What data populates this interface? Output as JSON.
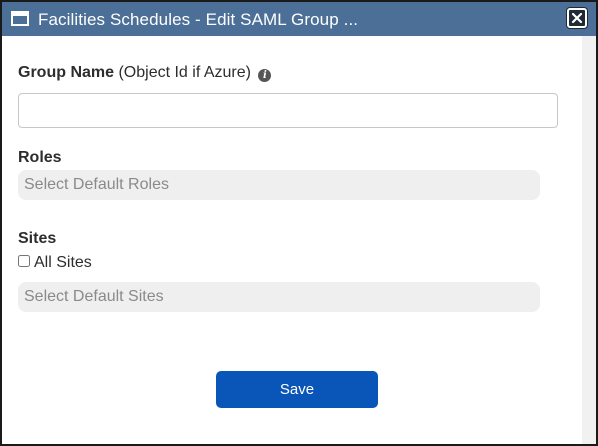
{
  "dialog": {
    "title": "Facilities Schedules - Edit SAML Group ...",
    "close_icon": "close-icon",
    "window_icon": "window-icon"
  },
  "form": {
    "group_name_label": "Group Name",
    "group_name_hint": "(Object Id if Azure)",
    "group_name_value": "",
    "group_name_placeholder": "",
    "info_icon": "info-icon",
    "roles_label": "Roles",
    "roles_placeholder": "Select Default Roles",
    "sites_label": "Sites",
    "all_sites_label": "All Sites",
    "all_sites_checked": false,
    "sites_placeholder": "Select Default Sites",
    "save_label": "Save"
  },
  "colors": {
    "titlebar": "#4b6f96",
    "primary_button": "#0a56b8",
    "select_background": "#efefef"
  }
}
